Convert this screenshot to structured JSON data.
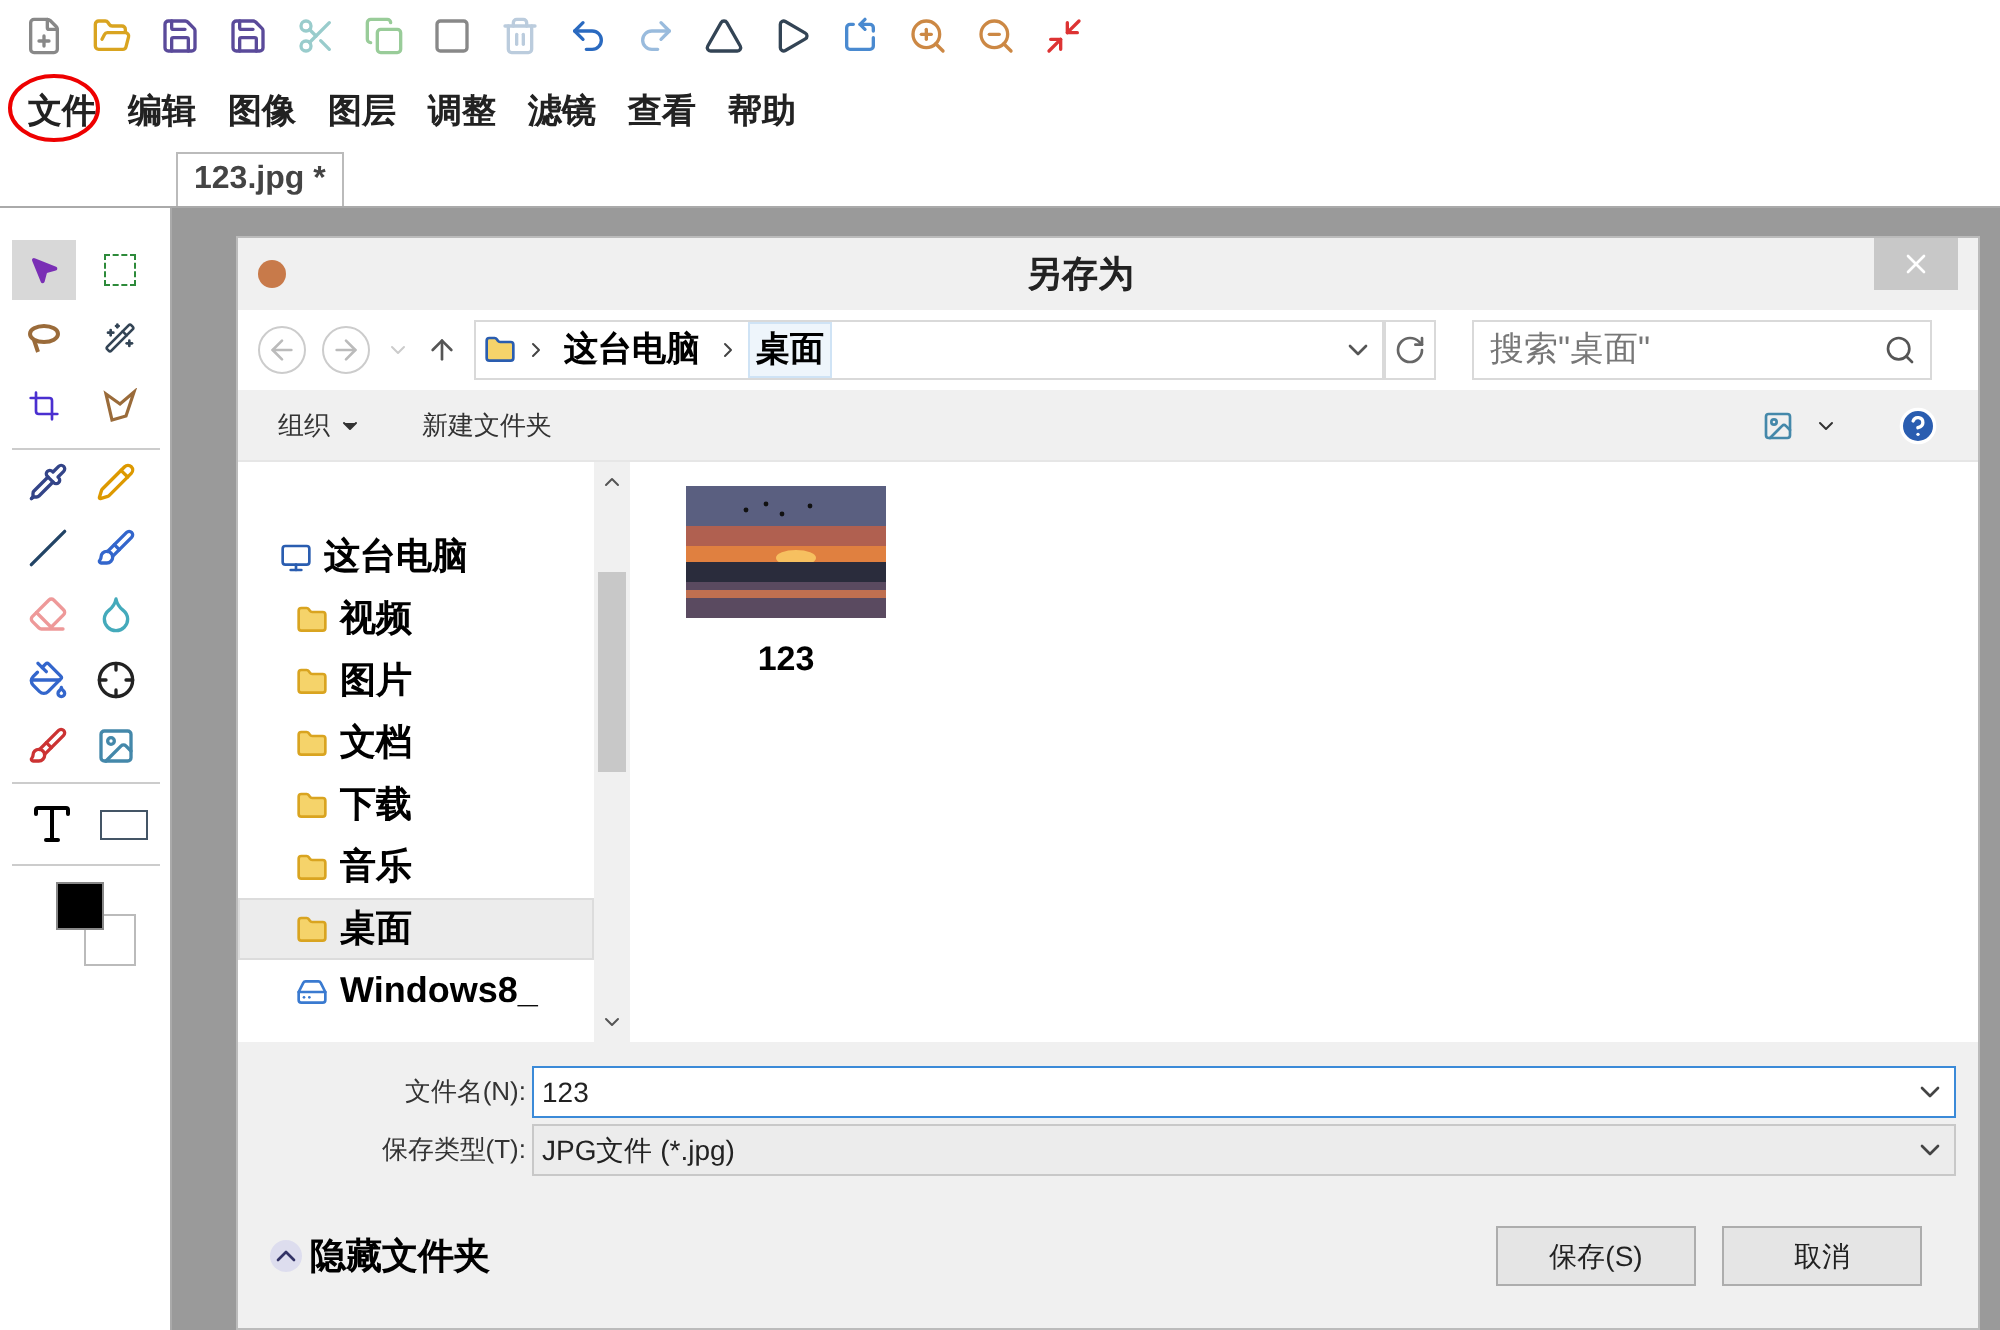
{
  "menu": [
    {
      "label": "文件",
      "circled": true
    },
    {
      "label": "编辑",
      "circled": false
    },
    {
      "label": "图像",
      "circled": false
    },
    {
      "label": "图层",
      "circled": false
    },
    {
      "label": "调整",
      "circled": false
    },
    {
      "label": "滤镜",
      "circled": false
    },
    {
      "label": "查看",
      "circled": false
    },
    {
      "label": "帮助",
      "circled": false
    }
  ],
  "document_tab": {
    "label": "123.jpg *"
  },
  "tools": [
    {
      "kind": "pointer",
      "selected": true
    },
    {
      "kind": "marquee",
      "selected": false
    },
    {
      "kind": "lasso",
      "selected": false
    },
    {
      "kind": "wand",
      "selected": false
    },
    {
      "kind": "crop",
      "selected": false
    },
    {
      "kind": "polylasso",
      "selected": false
    }
  ],
  "dialog": {
    "title": "另存为",
    "breadcrumbs": [
      {
        "label": "这台电脑",
        "selected": false
      },
      {
        "label": "桌面",
        "selected": true
      }
    ],
    "search": {
      "placeholder": "搜索\"桌面\""
    },
    "commands": [
      {
        "label": "组织",
        "dropdown": true
      },
      {
        "label": "新建文件夹",
        "dropdown": false
      }
    ],
    "nav": [
      {
        "label": "这台电脑",
        "kind": "computer",
        "selected": false,
        "children": [
          {
            "label": "视频",
            "kind": "folder",
            "selected": false
          },
          {
            "label": "图片",
            "kind": "folder",
            "selected": false
          },
          {
            "label": "文档",
            "kind": "folder",
            "selected": false
          },
          {
            "label": "下载",
            "kind": "folder",
            "selected": false
          },
          {
            "label": "音乐",
            "kind": "folder",
            "selected": false
          },
          {
            "label": "桌面",
            "kind": "folder",
            "selected": true
          },
          {
            "label": "Windows8_",
            "kind": "drive",
            "selected": false
          }
        ]
      }
    ],
    "files": [
      {
        "name": "123",
        "kind": "picture"
      }
    ],
    "filename": {
      "label": "文件名(N):",
      "value": "123"
    },
    "filetype": {
      "label": "保存类型(T):",
      "value": "JPG文件 (*.jpg)"
    },
    "hide_folders": "隐藏文件夹",
    "buttons": [
      {
        "label": "保存(S)"
      },
      {
        "label": "取消"
      }
    ]
  }
}
